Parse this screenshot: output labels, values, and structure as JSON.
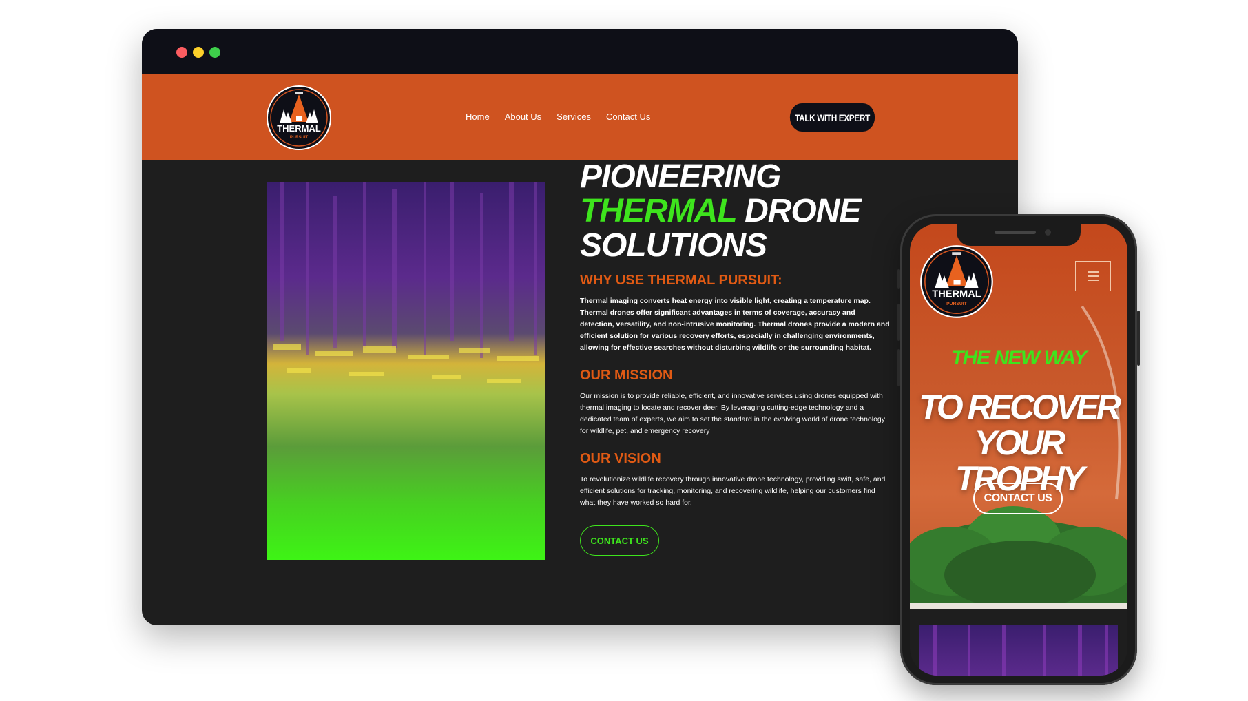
{
  "desktop": {
    "nav": [
      "Home",
      "About Us",
      "Services",
      "Contact Us"
    ],
    "header_cta": "TALK WITH EXPERT",
    "logo_text": "THERMAL PURSUIT",
    "hero": {
      "line1": "PIONEERING",
      "line2_green": "THERMAL",
      "line2_rest": " DRONE",
      "line3": "SOLUTIONS"
    },
    "sections": [
      {
        "heading": "WHY USE THERMAL PURSUIT:",
        "body": "Thermal imaging converts heat energy into visible light, creating a temperature map. Thermal drones offer significant advantages in terms of coverage, accuracy and detection, versatility, and non-intrusive monitoring. Thermal drones provide a modern and efficient solution for various recovery efforts, especially in challenging environments, allowing for effective searches without disturbing wildlife or the surrounding habitat."
      },
      {
        "heading": "OUR MISSION",
        "body": "Our mission is to provide reliable, efficient, and innovative services using drones equipped with thermal imaging to locate and recover deer. By leveraging cutting-edge technology and a dedicated team of experts, we aim to set the standard in the evolving world of drone technology for wildlife, pet, and emergency recovery"
      },
      {
        "heading": "OUR VISION",
        "body": "To revolutionize wildlife recovery through innovative drone technology, providing swift, safe, and efficient solutions for tracking, monitoring, and recovering wildlife, helping our customers find what they have worked so hard for."
      }
    ],
    "content_cta": "CONTACT US"
  },
  "mobile": {
    "logo_text": "THERMAL PURSUIT",
    "tagline": "THE NEW WAY",
    "title_line1": "TO RECOVER",
    "title_line2": "YOUR TROPHY",
    "cta": "CONTACT US"
  },
  "colors": {
    "orange": "#cf5320",
    "accent_orange": "#e05a14",
    "green": "#3ee41d",
    "dark": "#0e0f17",
    "panel": "#1e1e1e"
  }
}
